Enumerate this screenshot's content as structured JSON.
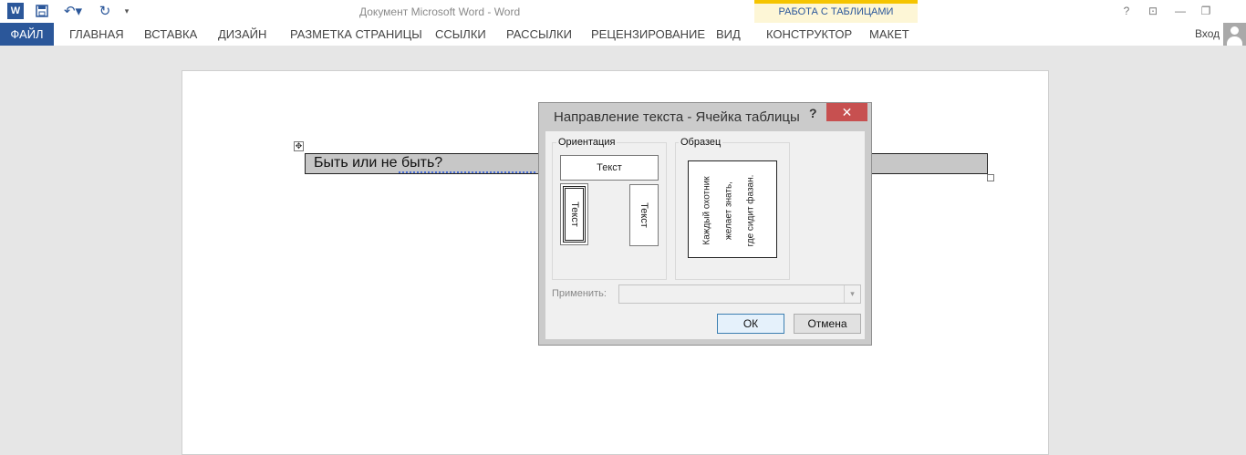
{
  "quick_access": {
    "word_logo": "W",
    "icons": [
      "word-icon",
      "save-icon",
      "undo-icon",
      "redo-icon",
      "customize-icon"
    ],
    "undo_glyph": "↶▾",
    "redo_glyph": "↻",
    "more_glyph": "▾"
  },
  "window": {
    "title": "Документ Microsoft Word - Word",
    "context_group": "РАБОТА С ТАБЛИЦАМИ",
    "help": "?",
    "ribbon_options": "⊡",
    "minimize": "—",
    "restore": "❐",
    "sign_in": "Вход"
  },
  "ribbon": {
    "tabs": [
      "ФАЙЛ",
      "ГЛАВНАЯ",
      "ВСТАВКА",
      "ДИЗАЙН",
      "РАЗМЕТКА СТРАНИЦЫ",
      "ССЫЛКИ",
      "РАССЫЛКИ",
      "РЕЦЕНЗИРОВАНИЕ",
      "ВИД",
      "КОНСТРУКТОР",
      "МАКЕТ"
    ]
  },
  "document": {
    "cell_text": "Быть или не быть?",
    "move_handle": "✥"
  },
  "dialog": {
    "title": "Направление текста - Ячейка таблицы",
    "help": "?",
    "close": "✕",
    "orientation_label": "Ориентация",
    "sample_label": "Образец",
    "option_text": "Текст",
    "sample_lines": [
      "Каждый охотник",
      "желает знать,",
      "где сидит фазан."
    ],
    "apply_label": "Применить:",
    "apply_value": "",
    "apply_arrow": "▾",
    "ok": "ОК",
    "cancel": "Отмена"
  },
  "colors": {
    "file_tab": "#2b579a",
    "context_band": "#fdf6d6",
    "context_accent": "#f5c400",
    "close_button": "#c75050"
  }
}
